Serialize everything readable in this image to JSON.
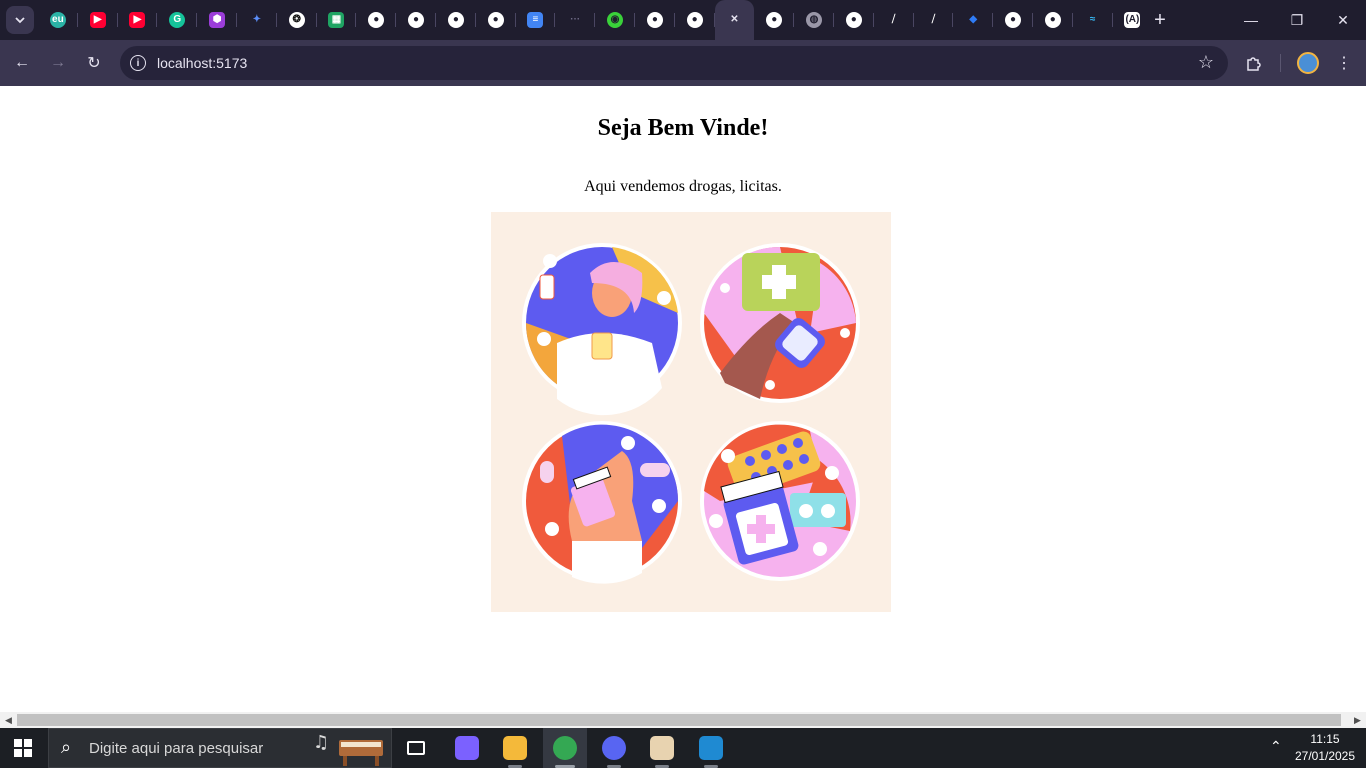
{
  "browser": {
    "tabs": [
      {
        "name": "tab-app-eu",
        "icon": "eu-logo-icon",
        "color": "#2bb3a6",
        "glyph": "eu",
        "round": true
      },
      {
        "name": "tab-youtube-1",
        "icon": "youtube-icon",
        "color": "#ff0033",
        "glyph": "▶"
      },
      {
        "name": "tab-youtube-2",
        "icon": "youtube-icon",
        "color": "#ff0033",
        "glyph": "▶"
      },
      {
        "name": "tab-grammarly",
        "icon": "grammarly-icon",
        "color": "#15c39a",
        "glyph": "G",
        "round": true
      },
      {
        "name": "tab-figma-like",
        "icon": "hexagon-app-icon",
        "color": "#9b3dd9",
        "glyph": "⬢"
      },
      {
        "name": "tab-gemini",
        "icon": "gemini-icon",
        "color": "transparent",
        "glyph": "✦",
        "fg": "#5b8df8"
      },
      {
        "name": "tab-chatgpt",
        "icon": "chatgpt-icon",
        "color": "#ffffff",
        "glyph": "❂",
        "fg": "#111",
        "round": true
      },
      {
        "name": "tab-google-sheets",
        "icon": "sheets-icon",
        "color": "#1fa463",
        "glyph": "▦"
      },
      {
        "name": "tab-github-1",
        "icon": "github-icon",
        "color": "#ffffff",
        "glyph": "●",
        "fg": "#1f1d2e",
        "round": true
      },
      {
        "name": "tab-github-2",
        "icon": "github-icon",
        "color": "#ffffff",
        "glyph": "●",
        "fg": "#1f1d2e",
        "round": true
      },
      {
        "name": "tab-github-3",
        "icon": "github-icon",
        "color": "#ffffff",
        "glyph": "●",
        "fg": "#1f1d2e",
        "round": true
      },
      {
        "name": "tab-github-4",
        "icon": "github-icon",
        "color": "#ffffff",
        "glyph": "●",
        "fg": "#1f1d2e",
        "round": true
      },
      {
        "name": "tab-google-docs",
        "icon": "docs-icon",
        "color": "#4285f4",
        "glyph": "≡"
      },
      {
        "name": "tab-loading",
        "icon": "loading-dots-icon",
        "color": "transparent",
        "glyph": "···",
        "fg": "#6e6a85"
      },
      {
        "name": "tab-globe-green",
        "icon": "globe-icon",
        "color": "#3ad13a",
        "glyph": "◉",
        "fg": "#1f1d2e",
        "round": true
      },
      {
        "name": "tab-github-5",
        "icon": "github-icon",
        "color": "#ffffff",
        "glyph": "●",
        "fg": "#1f1d2e",
        "round": true
      },
      {
        "name": "tab-github-6",
        "icon": "github-icon",
        "color": "#ffffff",
        "glyph": "●",
        "fg": "#1f1d2e",
        "round": true
      },
      {
        "name": "tab-active-localhost",
        "icon": "close-icon",
        "color": "transparent",
        "glyph": "✕",
        "fg": "#e6e3f0",
        "active": true
      },
      {
        "name": "tab-github-7",
        "icon": "github-icon",
        "color": "#ffffff",
        "glyph": "●",
        "fg": "#1f1d2e",
        "round": true
      },
      {
        "name": "tab-globe-grey",
        "icon": "globe-icon",
        "color": "#9a97a8",
        "glyph": "◍",
        "fg": "#1f1d2e",
        "round": true
      },
      {
        "name": "tab-github-8",
        "icon": "github-icon",
        "color": "#ffffff",
        "glyph": "●",
        "fg": "#1f1d2e",
        "round": true
      },
      {
        "name": "tab-link-1",
        "icon": "link-shape-icon",
        "color": "transparent",
        "glyph": "⧸",
        "fg": "#ffffff"
      },
      {
        "name": "tab-link-2",
        "icon": "link-shape-icon",
        "color": "transparent",
        "glyph": "⧸",
        "fg": "#ffffff"
      },
      {
        "name": "tab-jira",
        "icon": "jira-icon",
        "color": "transparent",
        "glyph": "◆",
        "fg": "#2f7cf6"
      },
      {
        "name": "tab-github-9",
        "icon": "github-icon",
        "color": "#ffffff",
        "glyph": "●",
        "fg": "#1f1d2e",
        "round": true
      },
      {
        "name": "tab-github-10",
        "icon": "github-icon",
        "color": "#ffffff",
        "glyph": "●",
        "fg": "#1f1d2e",
        "round": true
      },
      {
        "name": "tab-tailwind",
        "icon": "tailwind-icon",
        "color": "transparent",
        "glyph": "≈",
        "fg": "#38bdf8"
      },
      {
        "name": "tab-astro",
        "icon": "astro-icon",
        "color": "#ffffff",
        "glyph": "(A)",
        "fg": "#1f1d2e"
      }
    ],
    "url": "localhost:5173"
  },
  "page": {
    "heading": "Seja Bem Vinde!",
    "subtitle": "Aqui vendemos drogas, licitas."
  },
  "taskbar": {
    "search_placeholder": "Digite aqui para pesquisar",
    "apps": [
      {
        "name": "taskbar-task-view",
        "icon": "task-view-icon",
        "color": "transparent"
      },
      {
        "name": "taskbar-copilot",
        "icon": "copilot-icon",
        "color": "#7b61ff"
      },
      {
        "name": "taskbar-file-explorer",
        "icon": "folder-icon",
        "color": "#f4b93a"
      },
      {
        "name": "taskbar-chrome",
        "icon": "chrome-icon",
        "color": "#34a853",
        "active": true
      },
      {
        "name": "taskbar-discord",
        "icon": "discord-icon",
        "color": "#5865f2"
      },
      {
        "name": "taskbar-paint",
        "icon": "paint-icon",
        "color": "#e8d3b0"
      },
      {
        "name": "taskbar-vscode",
        "icon": "vscode-icon",
        "color": "#1f8ad2"
      }
    ],
    "time": "11:15",
    "date": "27/01/2025"
  }
}
